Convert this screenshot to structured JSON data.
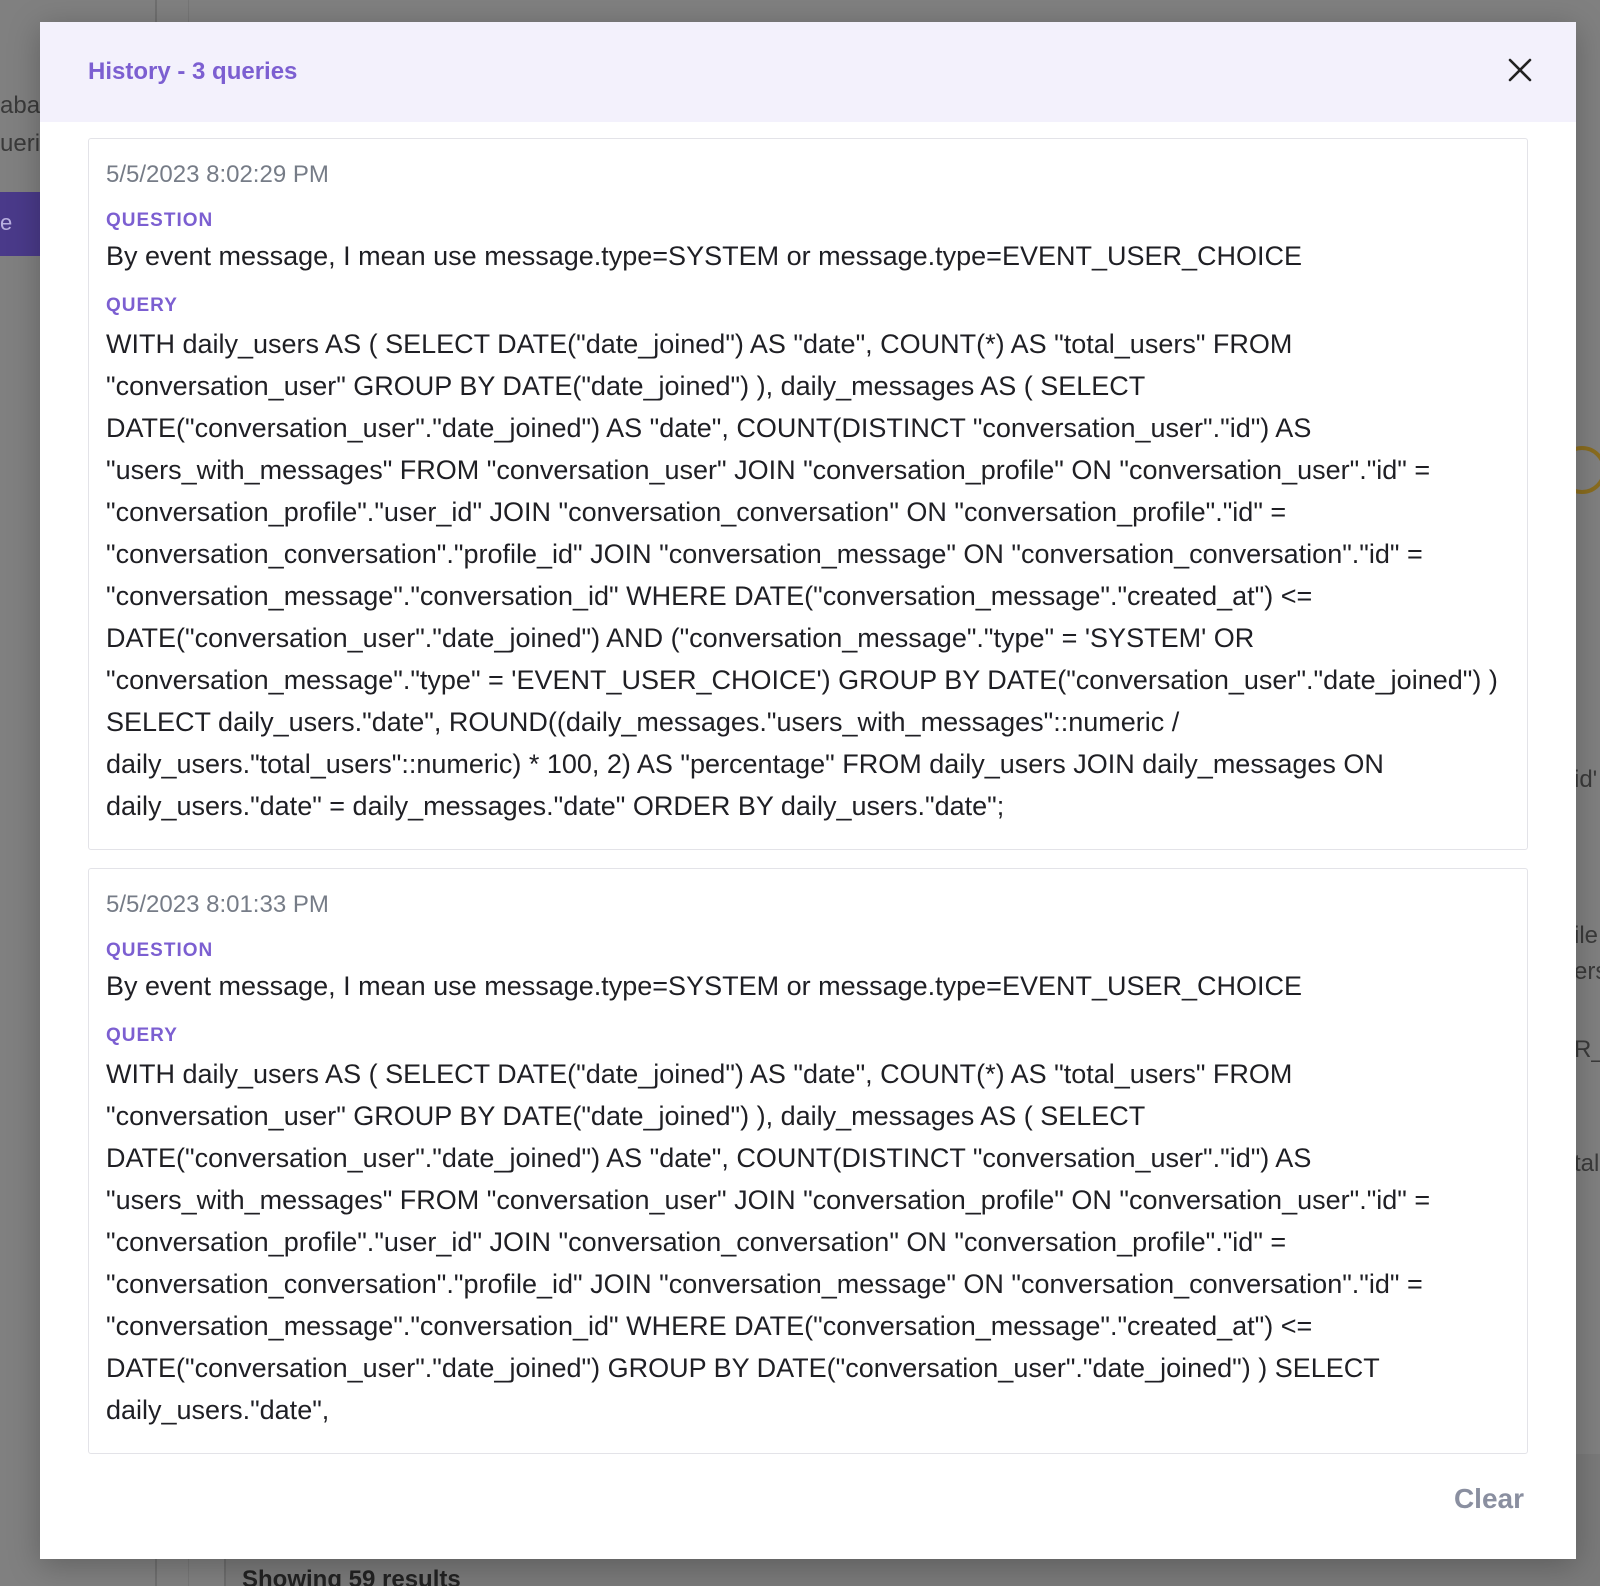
{
  "background": {
    "sidebar_fragments": [
      "aba",
      "ueri"
    ],
    "button_fragment": "e",
    "right_fragments": [
      "id'",
      "ile",
      "ers",
      "R_C",
      "tal"
    ],
    "results_text": "Showing 59 results"
  },
  "modal": {
    "title": "History - 3 queries",
    "close_icon": "close-icon",
    "clear_label": "Clear",
    "question_label": "QUESTION",
    "query_label": "QUERY",
    "entries": [
      {
        "timestamp": "5/5/2023 8:02:29 PM",
        "question": "By event message, I mean use message.type=SYSTEM or message.type=EVENT_USER_CHOICE",
        "query": "WITH daily_users AS ( SELECT DATE(\"date_joined\") AS \"date\", COUNT(*) AS \"total_users\" FROM \"conversation_user\" GROUP BY DATE(\"date_joined\") ), daily_messages AS ( SELECT DATE(\"conversation_user\".\"date_joined\") AS \"date\", COUNT(DISTINCT \"conversation_user\".\"id\") AS \"users_with_messages\" FROM \"conversation_user\" JOIN \"conversation_profile\" ON \"conversation_user\".\"id\" = \"conversation_profile\".\"user_id\" JOIN \"conversation_conversation\" ON \"conversation_profile\".\"id\" = \"conversation_conversation\".\"profile_id\" JOIN \"conversation_message\" ON \"conversation_conversation\".\"id\" = \"conversation_message\".\"conversation_id\" WHERE DATE(\"conversation_message\".\"created_at\") <= DATE(\"conversation_user\".\"date_joined\") AND (\"conversation_message\".\"type\" = 'SYSTEM' OR \"conversation_message\".\"type\" = 'EVENT_USER_CHOICE') GROUP BY DATE(\"conversation_user\".\"date_joined\") ) SELECT daily_users.\"date\", ROUND((daily_messages.\"users_with_messages\"::numeric / daily_users.\"total_users\"::numeric) * 100, 2) AS \"percentage\" FROM daily_users JOIN daily_messages ON daily_users.\"date\" = daily_messages.\"date\" ORDER BY daily_users.\"date\";"
      },
      {
        "timestamp": "5/5/2023 8:01:33 PM",
        "question": "By event message, I mean use message.type=SYSTEM or message.type=EVENT_USER_CHOICE",
        "query": "WITH daily_users AS ( SELECT DATE(\"date_joined\") AS \"date\", COUNT(*) AS \"total_users\" FROM \"conversation_user\" GROUP BY DATE(\"date_joined\") ), daily_messages AS ( SELECT DATE(\"conversation_user\".\"date_joined\") AS \"date\", COUNT(DISTINCT \"conversation_user\".\"id\") AS \"users_with_messages\" FROM \"conversation_user\" JOIN \"conversation_profile\" ON \"conversation_user\".\"id\" = \"conversation_profile\".\"user_id\" JOIN \"conversation_conversation\" ON \"conversation_profile\".\"id\" = \"conversation_conversation\".\"profile_id\" JOIN \"conversation_message\" ON \"conversation_conversation\".\"id\" = \"conversation_message\".\"conversation_id\" WHERE DATE(\"conversation_message\".\"created_at\") <= DATE(\"conversation_user\".\"date_joined\") GROUP BY DATE(\"conversation_user\".\"date_joined\") ) SELECT daily_users.\"date\","
      }
    ]
  },
  "colors": {
    "accent": "#7c5fd1",
    "header_bg": "#f3f1fc",
    "overlay": "#808080"
  }
}
